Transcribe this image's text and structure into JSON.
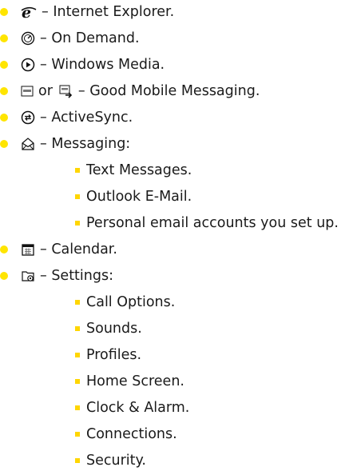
{
  "colors": {
    "bullet_primary": "#FFE500",
    "bullet_secondary": "#FFD600",
    "text": "#1a1a1a"
  },
  "items": [
    {
      "icon": "internet-explorer-icon",
      "text": "– Internet Explorer."
    },
    {
      "icon": "on-demand-icon",
      "text": "– On Demand."
    },
    {
      "icon": "windows-media-icon",
      "text": "– Windows Media."
    },
    {
      "icon": "good-mobile-messaging-icon",
      "connector": "or",
      "icon2": "good-mobile-messaging-arrow-icon",
      "text": "– Good Mobile Messaging."
    },
    {
      "icon": "activesync-icon",
      "text": "– ActiveSync."
    },
    {
      "icon": "messaging-icon",
      "text": "– Messaging:",
      "subitems": [
        "Text Messages.",
        "Outlook E-Mail.",
        "Personal email accounts you set up."
      ]
    },
    {
      "icon": "calendar-icon",
      "text": "– Calendar."
    },
    {
      "icon": "settings-icon",
      "text": "– Settings:",
      "subitems": [
        "Call Options.",
        "Sounds.",
        "Profiles.",
        "Home Screen.",
        "Clock & Alarm.",
        "Connections.",
        "Security."
      ]
    }
  ]
}
